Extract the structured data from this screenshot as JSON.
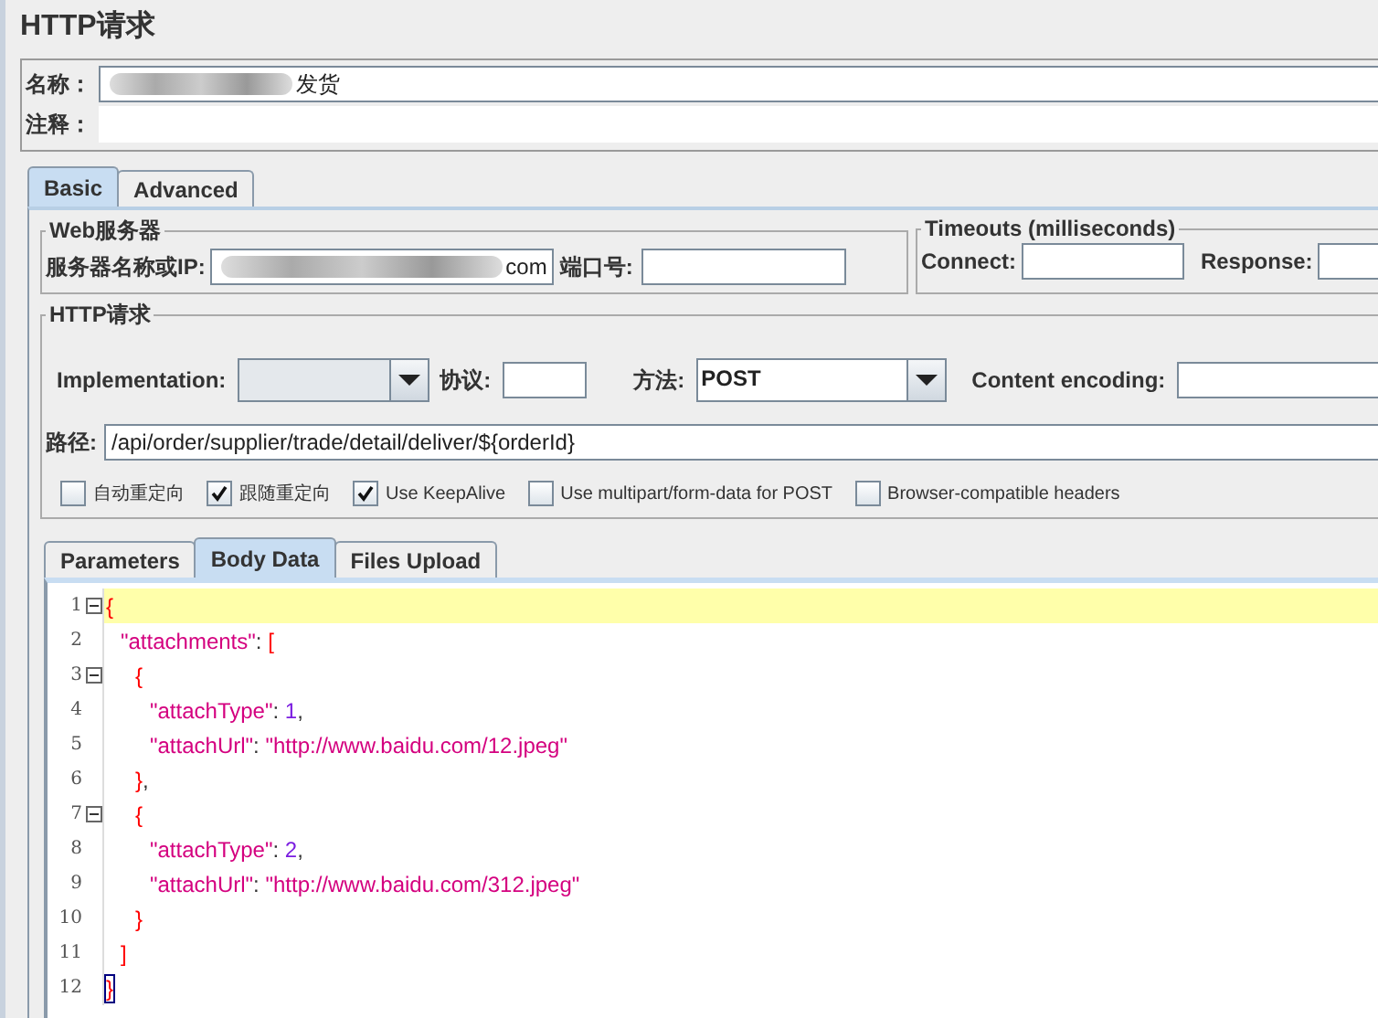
{
  "title": "HTTP请求",
  "name_field": {
    "label": "名称：",
    "value": "发货"
  },
  "comment_field": {
    "label": "注释："
  },
  "tabs": [
    {
      "label": "Basic",
      "selected": true
    },
    {
      "label": "Advanced",
      "selected": false
    }
  ],
  "web_server": {
    "title": "Web服务器",
    "server_label": "服务器名称或IP:",
    "server_value": "com",
    "port_label": "端口号:"
  },
  "timeouts": {
    "title": "Timeouts (milliseconds)",
    "connect_label": "Connect:",
    "response_label": "Response:"
  },
  "http_request": {
    "title": "HTTP请求",
    "implementation_label": "Implementation:",
    "implementation_disabled": true,
    "protocol_label": "协议:",
    "method_label": "方法:",
    "method_value": "POST",
    "encoding_label": "Content encoding:",
    "path_label": "路径:",
    "path_value": "/api/order/supplier/trade/detail/deliver/${orderId}"
  },
  "options": [
    {
      "label": "自动重定向",
      "checked": false
    },
    {
      "label": "跟随重定向",
      "checked": true
    },
    {
      "label": "Use KeepAlive",
      "checked": true
    },
    {
      "label": "Use multipart/form-data for POST",
      "checked": false
    },
    {
      "label": "Browser-compatible headers",
      "checked": false
    }
  ],
  "body_tabs": [
    {
      "label": "Parameters",
      "selected": false
    },
    {
      "label": "Body Data",
      "selected": true
    },
    {
      "label": "Files Upload",
      "selected": false
    }
  ],
  "editor": {
    "lines": [
      {
        "number": "1",
        "fold": true,
        "current": true,
        "tokens": [
          {
            "kind": "brace",
            "text": "{"
          }
        ]
      },
      {
        "number": "2",
        "fold": false,
        "current": false,
        "tokens": [
          {
            "kind": "string",
            "text": "\"attachments\""
          },
          {
            "kind": "plain",
            "text": ": "
          },
          {
            "kind": "brace",
            "text": "["
          }
        ]
      },
      {
        "number": "3",
        "fold": true,
        "current": false,
        "tokens": [
          {
            "kind": "brace",
            "text": "{"
          }
        ]
      },
      {
        "number": "4",
        "fold": false,
        "current": false,
        "tokens": [
          {
            "kind": "string",
            "text": "\"attachType\""
          },
          {
            "kind": "plain",
            "text": ": "
          },
          {
            "kind": "number",
            "text": "1"
          },
          {
            "kind": "plain",
            "text": ","
          }
        ]
      },
      {
        "number": "5",
        "fold": false,
        "current": false,
        "tokens": [
          {
            "kind": "string",
            "text": "\"attachUrl\""
          },
          {
            "kind": "plain",
            "text": ": "
          },
          {
            "kind": "string",
            "text": "\"http://www.baidu.com/12.jpeg\""
          }
        ]
      },
      {
        "number": "6",
        "fold": false,
        "current": false,
        "tokens": [
          {
            "kind": "brace",
            "text": "}"
          },
          {
            "kind": "plain",
            "text": ","
          }
        ]
      },
      {
        "number": "7",
        "fold": true,
        "current": false,
        "tokens": [
          {
            "kind": "brace",
            "text": "{"
          }
        ]
      },
      {
        "number": "8",
        "fold": false,
        "current": false,
        "tokens": [
          {
            "kind": "string",
            "text": "\"attachType\""
          },
          {
            "kind": "plain",
            "text": ": "
          },
          {
            "kind": "number",
            "text": "2"
          },
          {
            "kind": "plain",
            "text": ","
          }
        ]
      },
      {
        "number": "9",
        "fold": false,
        "current": false,
        "tokens": [
          {
            "kind": "string",
            "text": "\"attachUrl\""
          },
          {
            "kind": "plain",
            "text": ": "
          },
          {
            "kind": "string",
            "text": "\"http://www.baidu.com/312.jpeg\""
          }
        ]
      },
      {
        "number": "10",
        "fold": false,
        "current": false,
        "tokens": [
          {
            "kind": "brace",
            "text": "}"
          }
        ]
      },
      {
        "number": "11",
        "fold": false,
        "current": false,
        "tokens": [
          {
            "kind": "brace",
            "text": "]"
          }
        ]
      },
      {
        "number": "12",
        "fold": false,
        "current": false,
        "tokens": [
          {
            "kind": "matched",
            "text": "}"
          }
        ]
      }
    ]
  }
}
